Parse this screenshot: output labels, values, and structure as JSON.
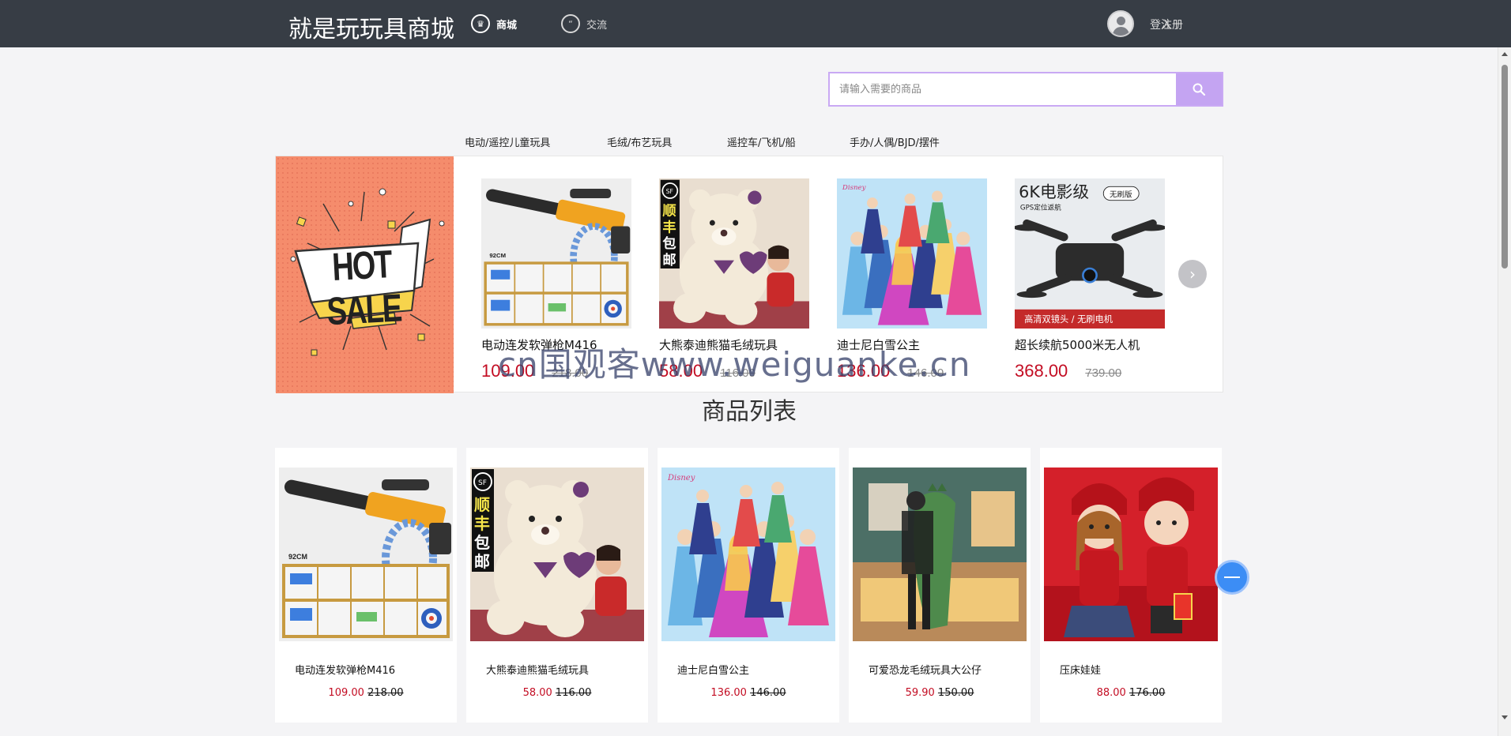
{
  "header": {
    "brand": "就是玩玩具商城",
    "nav_mall": "商城",
    "nav_chat": "交流",
    "login": "登入",
    "register": "注册"
  },
  "search": {
    "placeholder": "请输入需要的商品",
    "value": ""
  },
  "categories": [
    "电动/遥控儿童玩具",
    "毛绒/布艺玩具",
    "遥控车/飞机/船",
    "手办/人偶/BJD/摆件"
  ],
  "hot": {
    "banner_text": "HOT SALE",
    "items": [
      {
        "name": "电动连发软弹枪M416",
        "price": "109.00",
        "old": "218.00"
      },
      {
        "name": "大熊泰迪熊猫毛绒玩具",
        "price": "58.00",
        "old": "116.00"
      },
      {
        "name": "迪士尼白雪公主",
        "price": "136.00",
        "old": "146.00"
      },
      {
        "name": "超长续航5000米无人机",
        "price": "368.00",
        "old": "739.00"
      }
    ],
    "img_texts": {
      "gun_label": "92CM",
      "sf1": "顺",
      "sf2": "丰",
      "sf3": "包",
      "sf4": "邮",
      "drone_title": "6K电影级",
      "drone_badge": "无刷版",
      "drone_sub": "GPS定位返航",
      "drone_bottom": "高清双镜头 / 无刷电机"
    }
  },
  "watermark": "cn国观客www.weiguanke.cn",
  "section_title": "商品列表",
  "products": [
    {
      "name": "电动连发软弹枪M416",
      "price": "109.00",
      "old": "218.00"
    },
    {
      "name": "大熊泰迪熊猫毛绒玩具",
      "price": "58.00",
      "old": "116.00"
    },
    {
      "name": "迪士尼白雪公主",
      "price": "136.00",
      "old": "146.00"
    },
    {
      "name": "可爱恐龙毛绒玩具大公仔",
      "price": "59.90",
      "old": "150.00"
    },
    {
      "name": "压床娃娃",
      "price": "88.00",
      "old": "176.00"
    }
  ],
  "colors": {
    "topbar": "#373d45",
    "price_red": "#c30d23",
    "search_border": "#c9a9f4",
    "hot_banner": "#f58c6c"
  }
}
